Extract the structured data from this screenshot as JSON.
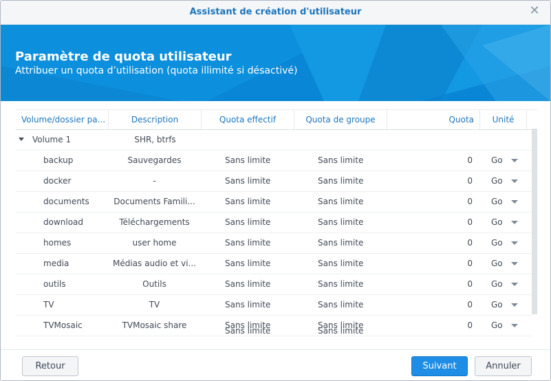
{
  "window": {
    "title": "Assistant de création d'utilisateur",
    "close_icon": "close-icon"
  },
  "banner": {
    "title": "Paramètre de quota utilisateur",
    "subtitle": "Attribuer un quota d’utilisation (quota illimité si désactivé)"
  },
  "table": {
    "columns": {
      "volume": "Volume/dossier pa...",
      "description": "Description",
      "quota_effectif": "Quota effectif",
      "quota_groupe": "Quota de groupe",
      "quota": "Quota",
      "unite": "Unité"
    },
    "group": {
      "name": "Volume 1",
      "description": "SHR, btrfs"
    },
    "rows": [
      {
        "name": "backup",
        "description": "Sauvegardes",
        "effectif": "Sans limite",
        "groupe": "Sans limite",
        "quota": "0",
        "unit": "Go"
      },
      {
        "name": "docker",
        "description": "-",
        "effectif": "Sans limite",
        "groupe": "Sans limite",
        "quota": "0",
        "unit": "Go"
      },
      {
        "name": "documents",
        "description": "Documents Famili...",
        "effectif": "Sans limite",
        "groupe": "Sans limite",
        "quota": "0",
        "unit": "Go"
      },
      {
        "name": "download",
        "description": "Téléchargements",
        "effectif": "Sans limite",
        "groupe": "Sans limite",
        "quota": "0",
        "unit": "Go"
      },
      {
        "name": "homes",
        "description": "user home",
        "effectif": "Sans limite",
        "groupe": "Sans limite",
        "quota": "0",
        "unit": "Go"
      },
      {
        "name": "media",
        "description": "Médias audio et vi...",
        "effectif": "Sans limite",
        "groupe": "Sans limite",
        "quota": "0",
        "unit": "Go"
      },
      {
        "name": "outils",
        "description": "Outils",
        "effectif": "Sans limite",
        "groupe": "Sans limite",
        "quota": "0",
        "unit": "Go"
      },
      {
        "name": "TV",
        "description": "TV",
        "effectif": "Sans limite",
        "groupe": "Sans limite",
        "quota": "0",
        "unit": "Go"
      },
      {
        "name": "TVMosaic",
        "description": "TVMosaic share",
        "effectif": "Sans limite",
        "groupe": "Sans limite",
        "quota": "0",
        "unit": "Go"
      }
    ]
  },
  "footer": {
    "back": "Retour",
    "next": "Suivant",
    "cancel": "Annuler"
  },
  "colors": {
    "accent": "#1c75bc",
    "primary_button": "#1e8de5",
    "banner": "#0b8bd8"
  }
}
